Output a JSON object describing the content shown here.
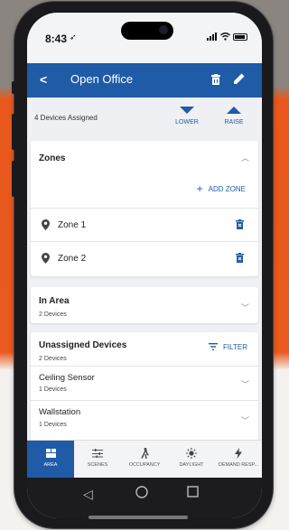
{
  "status_bar": {
    "time": "8:43"
  },
  "app_bar": {
    "title": "Open Office"
  },
  "devices_assigned": "4 Devices Assigned",
  "controls": {
    "lower": "LOWER",
    "raise": "RAISE"
  },
  "zones_card": {
    "title": "Zones",
    "add_zone": "ADD ZONE",
    "zones": [
      {
        "label": "Zone 1"
      },
      {
        "label": "Zone 2"
      }
    ]
  },
  "in_area_card": {
    "title": "In Area",
    "subtitle": "2 Devices"
  },
  "unassigned_card": {
    "title": "Unassigned Devices",
    "subtitle": "2 Devices",
    "filter": "FILTER",
    "items": [
      {
        "label": "Ceiling Sensor",
        "subtitle": "1 Devices"
      },
      {
        "label": "Wallstation",
        "subtitle": "1 Devices"
      }
    ]
  },
  "tabs": [
    {
      "label": "AREA",
      "icon": "area-icon",
      "active": true
    },
    {
      "label": "SCENES",
      "icon": "scenes-icon",
      "active": false
    },
    {
      "label": "OCCUPANCY",
      "icon": "occupancy-icon",
      "active": false
    },
    {
      "label": "DAYLIGHT",
      "icon": "daylight-icon",
      "active": false
    },
    {
      "label": "DEMAND RESP...",
      "icon": "demand-response-icon",
      "active": false
    }
  ],
  "colors": {
    "primary": "#1f5ba6",
    "background_orange": "#e85a1e"
  }
}
